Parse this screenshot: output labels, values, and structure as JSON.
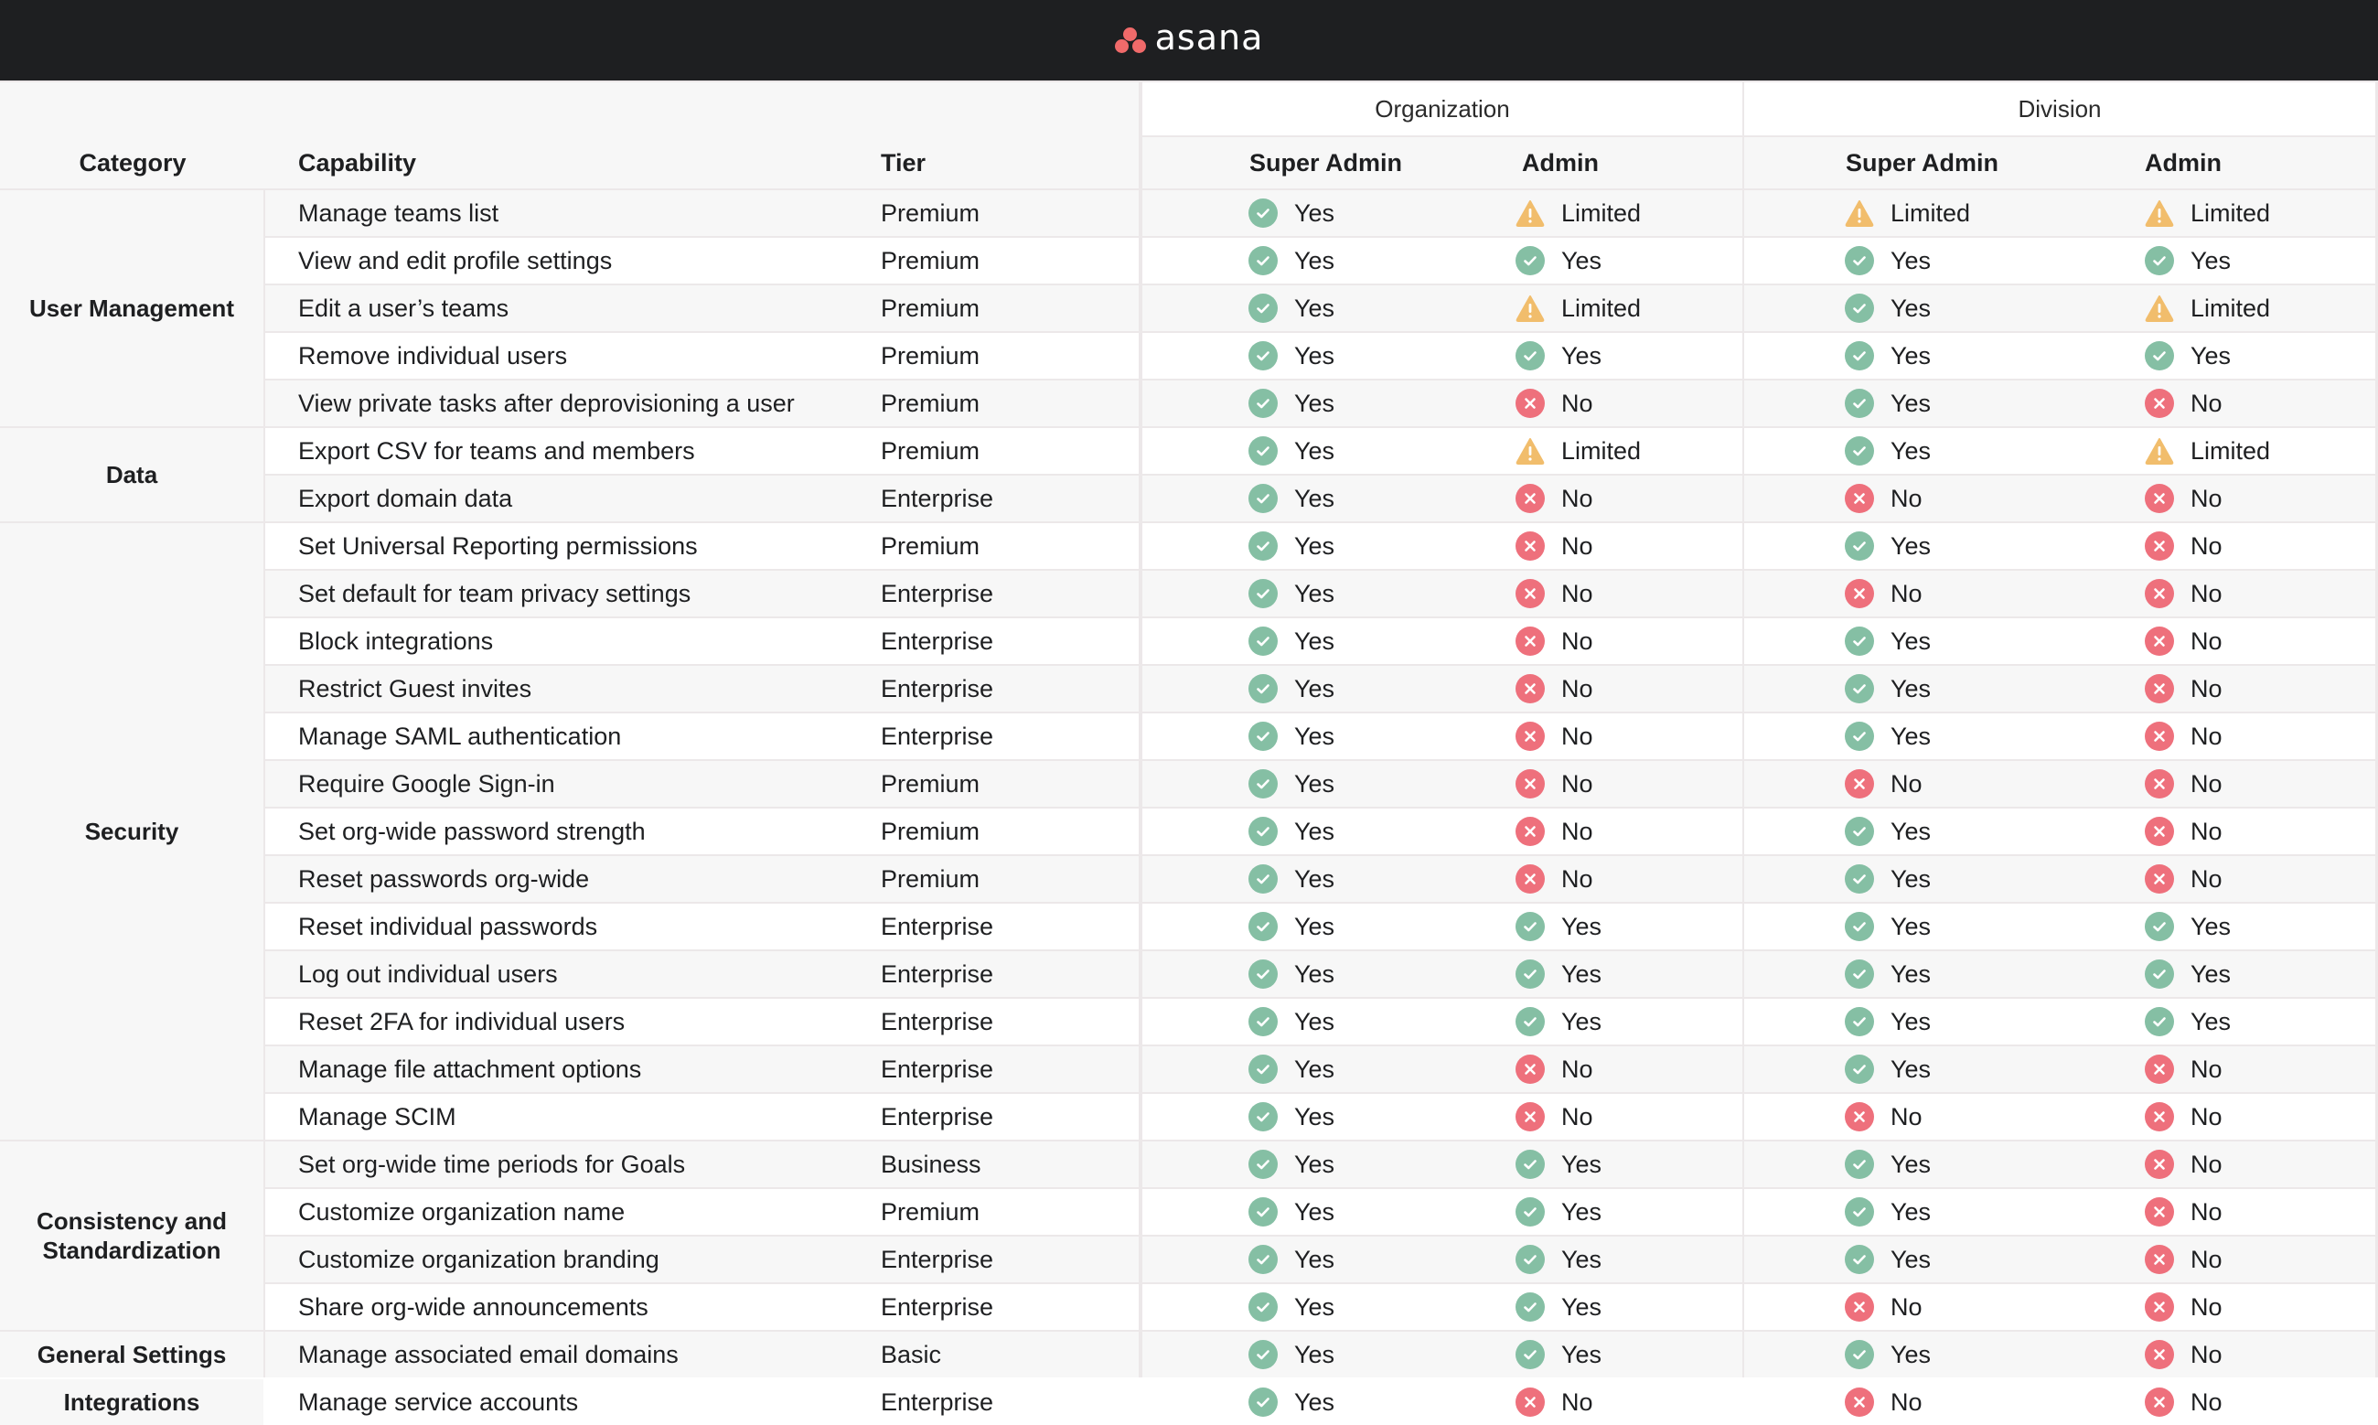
{
  "app": {
    "logo_text": "asana"
  },
  "colors": {
    "yes": "#85bfa4",
    "no": "#ee707c",
    "limited": "#f1bd6c",
    "header_bg": "#1e1f21",
    "logo": "#f06a6a"
  },
  "header": {
    "category": "Category",
    "capability": "Capability",
    "tier": "Tier",
    "groups": [
      "Organization",
      "Division"
    ],
    "roles": [
      "Super Admin",
      "Admin",
      "Super Admin",
      "Admin"
    ]
  },
  "categories": [
    {
      "label": "User Management",
      "rows": 5
    },
    {
      "label": "Data",
      "rows": 2
    },
    {
      "label": "Security",
      "rows": 13
    },
    {
      "label": "Consistency and Standardization",
      "rows": 4
    },
    {
      "label": "General Settings",
      "rows": 1
    },
    {
      "label": "Integrations",
      "rows": 1
    }
  ],
  "rows": [
    {
      "capability": "Manage teams list",
      "tier": "Premium",
      "values": [
        "Yes",
        "Limited",
        "Limited",
        "Limited"
      ]
    },
    {
      "capability": "View and edit profile settings",
      "tier": "Premium",
      "values": [
        "Yes",
        "Yes",
        "Yes",
        "Yes"
      ]
    },
    {
      "capability": "Edit a user’s teams",
      "tier": "Premium",
      "values": [
        "Yes",
        "Limited",
        "Yes",
        "Limited"
      ]
    },
    {
      "capability": "Remove individual users",
      "tier": "Premium",
      "values": [
        "Yes",
        "Yes",
        "Yes",
        "Yes"
      ]
    },
    {
      "capability": "View private tasks after deprovisioning a user",
      "tier": "Premium",
      "values": [
        "Yes",
        "No",
        "Yes",
        "No"
      ]
    },
    {
      "capability": "Export CSV for teams and members",
      "tier": "Premium",
      "values": [
        "Yes",
        "Limited",
        "Yes",
        "Limited"
      ]
    },
    {
      "capability": "Export domain data",
      "tier": "Enterprise",
      "values": [
        "Yes",
        "No",
        "No",
        "No"
      ]
    },
    {
      "capability": "Set Universal Reporting permissions",
      "tier": "Premium",
      "values": [
        "Yes",
        "No",
        "Yes",
        "No"
      ]
    },
    {
      "capability": "Set default for team privacy settings",
      "tier": "Enterprise",
      "values": [
        "Yes",
        "No",
        "No",
        "No"
      ]
    },
    {
      "capability": "Block integrations",
      "tier": "Enterprise",
      "values": [
        "Yes",
        "No",
        "Yes",
        "No"
      ]
    },
    {
      "capability": "Restrict Guest invites",
      "tier": "Enterprise",
      "values": [
        "Yes",
        "No",
        "Yes",
        "No"
      ]
    },
    {
      "capability": "Manage SAML authentication",
      "tier": "Enterprise",
      "values": [
        "Yes",
        "No",
        "Yes",
        "No"
      ]
    },
    {
      "capability": "Require Google Sign-in",
      "tier": "Premium",
      "values": [
        "Yes",
        "No",
        "No",
        "No"
      ]
    },
    {
      "capability": "Set org-wide password strength",
      "tier": "Premium",
      "values": [
        "Yes",
        "No",
        "Yes",
        "No"
      ]
    },
    {
      "capability": "Reset passwords org-wide",
      "tier": "Premium",
      "values": [
        "Yes",
        "No",
        "Yes",
        "No"
      ]
    },
    {
      "capability": "Reset individual passwords",
      "tier": "Enterprise",
      "values": [
        "Yes",
        "Yes",
        "Yes",
        "Yes"
      ]
    },
    {
      "capability": "Log out individual users",
      "tier": "Enterprise",
      "values": [
        "Yes",
        "Yes",
        "Yes",
        "Yes"
      ]
    },
    {
      "capability": "Reset 2FA for individual users",
      "tier": "Enterprise",
      "values": [
        "Yes",
        "Yes",
        "Yes",
        "Yes"
      ]
    },
    {
      "capability": "Manage file attachment options",
      "tier": "Enterprise",
      "values": [
        "Yes",
        "No",
        "Yes",
        "No"
      ]
    },
    {
      "capability": "Manage SCIM",
      "tier": "Enterprise",
      "values": [
        "Yes",
        "No",
        "No",
        "No"
      ]
    },
    {
      "capability": "Set org-wide time periods for Goals",
      "tier": "Business",
      "values": [
        "Yes",
        "Yes",
        "Yes",
        "No"
      ]
    },
    {
      "capability": "Customize organization name",
      "tier": "Premium",
      "values": [
        "Yes",
        "Yes",
        "Yes",
        "No"
      ]
    },
    {
      "capability": "Customize organization branding",
      "tier": "Enterprise",
      "values": [
        "Yes",
        "Yes",
        "Yes",
        "No"
      ]
    },
    {
      "capability": "Share org-wide announcements",
      "tier": "Enterprise",
      "values": [
        "Yes",
        "Yes",
        "No",
        "No"
      ]
    },
    {
      "capability": "Manage associated email domains",
      "tier": "Basic",
      "values": [
        "Yes",
        "Yes",
        "Yes",
        "No"
      ]
    },
    {
      "capability": "Manage service accounts",
      "tier": "Enterprise",
      "values": [
        "Yes",
        "No",
        "No",
        "No"
      ]
    }
  ]
}
